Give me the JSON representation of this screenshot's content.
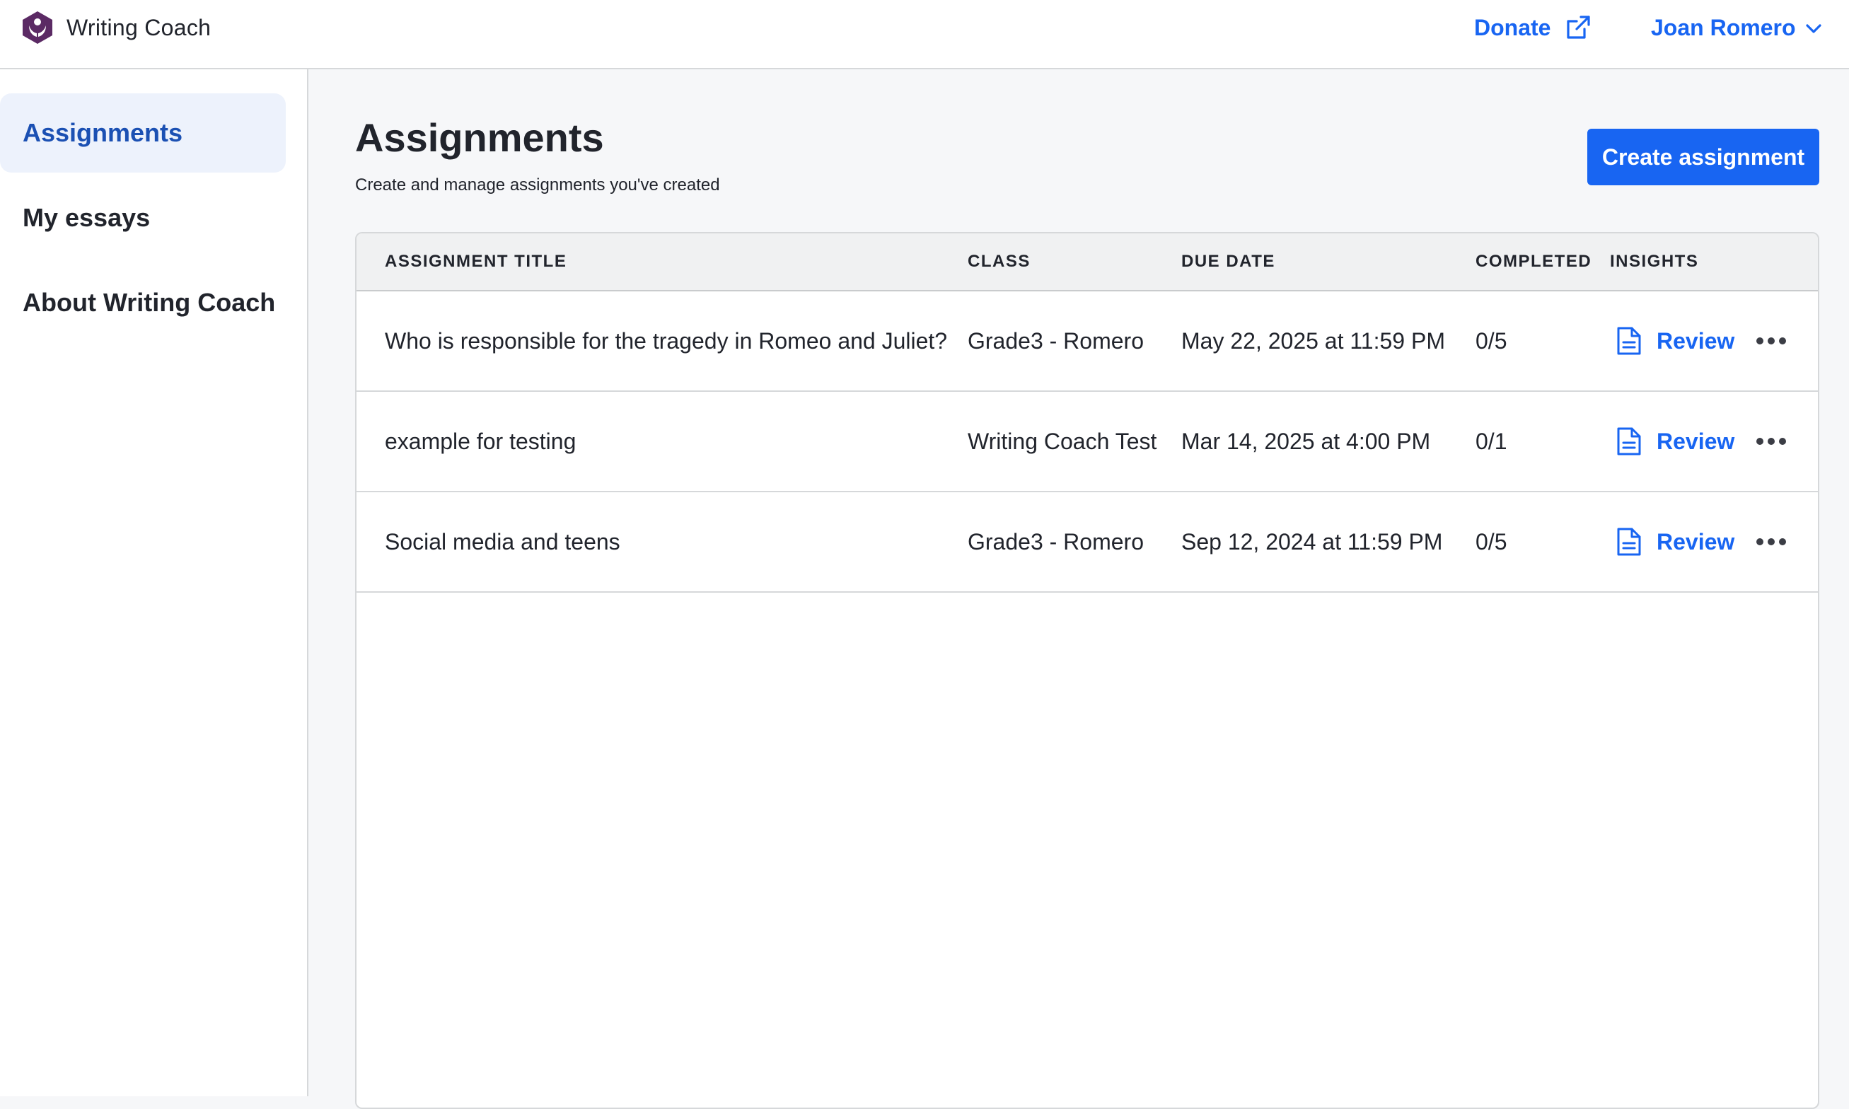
{
  "header": {
    "app_name": "Writing Coach",
    "logo_icon": "khan-academy-logo-icon",
    "donate_label": "Donate",
    "user_name": "Joan Romero",
    "accent_color": "#1865f2"
  },
  "sidebar": {
    "items": [
      {
        "label": "Assignments",
        "active": true
      },
      {
        "label": "My essays",
        "active": false
      },
      {
        "label": "About Writing Coach",
        "active": false
      }
    ]
  },
  "main": {
    "title": "Assignments",
    "subtitle": "Create and manage assignments you've created",
    "create_button_label": "Create assignment",
    "table": {
      "columns": [
        "ASSIGNMENT TITLE",
        "CLASS",
        "DUE DATE",
        "COMPLETED",
        "INSIGHTS"
      ],
      "rows": [
        {
          "title": "Who is responsible for the tragedy in Romeo and Juliet?",
          "class": "Grade3 - Romero",
          "due_date": "May 22, 2025 at 11:59 PM",
          "completed": "0/5",
          "insights_label": "Review"
        },
        {
          "title": "example for testing",
          "class": "Writing Coach Test",
          "due_date": "Mar 14, 2025 at 4:00 PM",
          "completed": "0/1",
          "insights_label": "Review"
        },
        {
          "title": "Social media and teens",
          "class": "Grade3 - Romero",
          "due_date": "Sep 12, 2024 at 11:59 PM",
          "completed": "0/5",
          "insights_label": "Review"
        }
      ]
    }
  }
}
